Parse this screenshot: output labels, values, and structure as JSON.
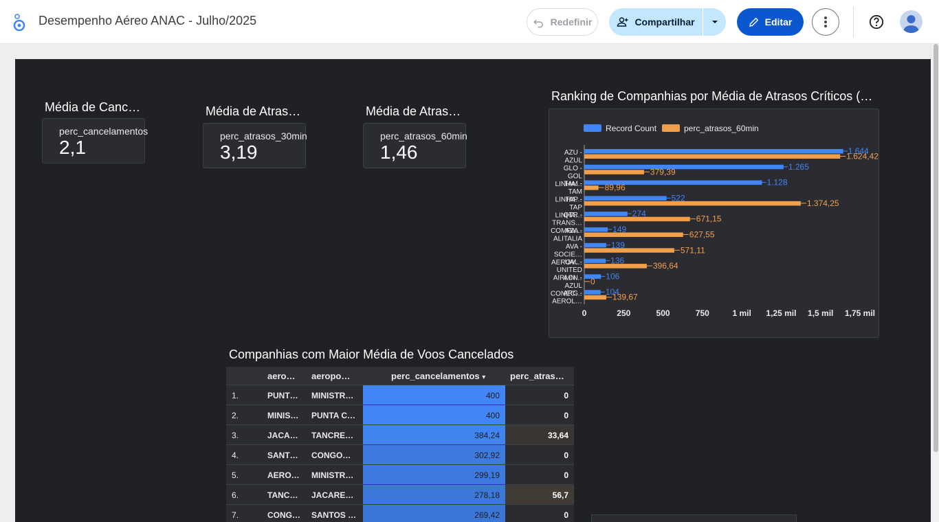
{
  "app": {
    "title": "Desempenho Aéreo ANAC - Julho/2025"
  },
  "toolbar": {
    "reset_label": "Redefinir",
    "share_label": "Compartilhar",
    "edit_label": "Editar"
  },
  "icons": [
    "looker-studio-logo-icon",
    "undo-icon",
    "add-person-icon",
    "caret-down-icon",
    "pencil-icon",
    "more-vert-icon",
    "help-icon",
    "account-avatar-icon"
  ],
  "colors": {
    "accent": "#0b57d0",
    "share_bg": "#c2e7ff",
    "series_blue": "#4285f4",
    "series_orange": "#f29f4c",
    "canvas": "#202124"
  },
  "scorecards": [
    {
      "title": "Média de Canc…",
      "label": "perc_cancelamentos",
      "value": "2,1"
    },
    {
      "title": "Média de Atras…",
      "label": "perc_atrasos_30min",
      "value": "3,19"
    },
    {
      "title": "Média de Atras…",
      "label": "perc_atrasos_60min",
      "value": "1,46"
    }
  ],
  "bar_chart": {
    "title": "Ranking de Companhias por Média de Atrasos Críticos (…",
    "legend": [
      "Record Count",
      "perc_atrasos_60min"
    ],
    "categories": [
      [
        "AZU -",
        "AZUL"
      ],
      [
        "GLO -",
        "GOL",
        "LINHA…"
      ],
      [
        "TAM -",
        "TAM",
        "LINHA…"
      ],
      [
        "TAP -",
        "TAP",
        "LINHA…"
      ],
      [
        "QTR -",
        "TRANS…",
        "COMPA…"
      ],
      [
        "AZA -",
        "ALITALIA"
      ],
      [
        "AVA -",
        "SOCIE…",
        "AEROV…"
      ],
      [
        "UAL -",
        "UNITED",
        "AIRLIN…"
      ],
      [
        "ACN -",
        "AZUL",
        "CONEC…"
      ],
      [
        "ARG -",
        "AEROL…"
      ]
    ],
    "record_count_labels": [
      "1.644",
      "1.265",
      "1.128",
      "522",
      "274",
      "149",
      "139",
      "136",
      "106",
      "104"
    ],
    "perc_labels": [
      "1.624,42",
      "379,39",
      "89,96",
      "1.374,25",
      "671,15",
      "627,55",
      "571,11",
      "396,64",
      "0",
      "139,67"
    ],
    "x_ticks": [
      "0",
      "250",
      "500",
      "750",
      "1 mil",
      "1,25 mil",
      "1,5 mil",
      "1,75 mil"
    ]
  },
  "chart_data": {
    "type": "bar",
    "orientation": "horizontal",
    "categories": [
      "AZU - AZUL",
      "GLO - GOL LINHA…",
      "TAM - TAM LINHA…",
      "TAP - TAP LINHA…",
      "QTR - TRANS… COMPA…",
      "AZA - ALITALIA",
      "AVA - SOCIE… AEROV…",
      "UAL - UNITED AIRLIN…",
      "ACN - AZUL CONEC…",
      "ARG - AEROL…"
    ],
    "series": [
      {
        "name": "Record Count",
        "color": "#4285f4",
        "values": [
          1644,
          1265,
          1128,
          522,
          274,
          149,
          139,
          136,
          106,
          104
        ]
      },
      {
        "name": "perc_atrasos_60min",
        "color": "#f29f4c",
        "values": [
          1624.42,
          379.39,
          89.96,
          1374.25,
          671.15,
          627.55,
          571.11,
          396.64,
          0,
          139.67
        ]
      }
    ],
    "xlim": [
      0,
      1750
    ],
    "legend_position": "top-left",
    "grid": false
  },
  "table": {
    "title": "Companhias com Maior Média de Voos Cancelados",
    "columns": [
      "aero…",
      "aeropo…",
      "perc_cancelamentos",
      "perc_atras…"
    ],
    "sort_icon": "▾",
    "rows": [
      {
        "idx": "1.",
        "a": "PUNT…",
        "b": "MINISTR…",
        "pc": "400",
        "pa": "0",
        "pc_v": 400,
        "pa_v": 0
      },
      {
        "idx": "2.",
        "a": "MINIS…",
        "b": "PUNTA C…",
        "pc": "400",
        "pa": "0",
        "pc_v": 400,
        "pa_v": 0
      },
      {
        "idx": "3.",
        "a": "JACA…",
        "b": "TANCRE…",
        "pc": "384,24",
        "pa": "33,64",
        "pc_v": 384.24,
        "pa_v": 33.64
      },
      {
        "idx": "4.",
        "a": "SANT…",
        "b": "CONGO…",
        "pc": "302,92",
        "pa": "0",
        "pc_v": 302.92,
        "pa_v": 0
      },
      {
        "idx": "5.",
        "a": "AERO…",
        "b": "MINISTR…",
        "pc": "299,19",
        "pa": "0",
        "pc_v": 299.19,
        "pa_v": 0
      },
      {
        "idx": "6.",
        "a": "TANC…",
        "b": "JACARE…",
        "pc": "278,18",
        "pa": "56,7",
        "pc_v": 278.18,
        "pa_v": 56.7
      },
      {
        "idx": "7.",
        "a": "CONG…",
        "b": "SANTOS …",
        "pc": "269,42",
        "pa": "0",
        "pc_v": 269.42,
        "pa_v": 0
      }
    ]
  }
}
